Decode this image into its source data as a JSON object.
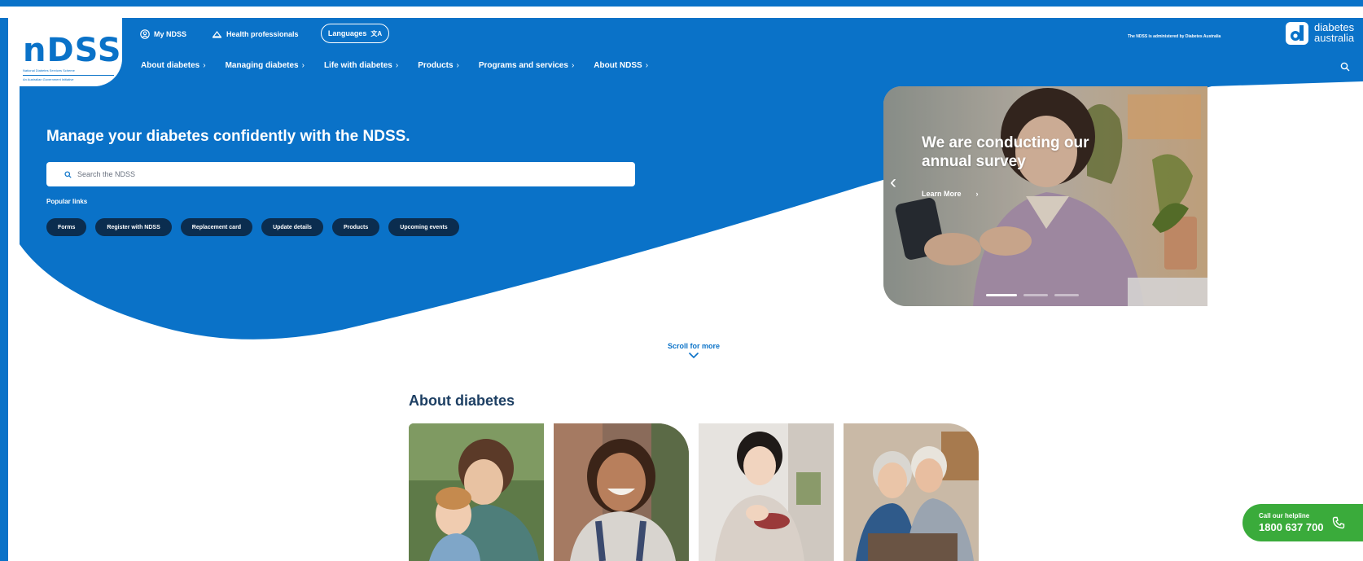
{
  "header": {
    "logo": {
      "text": "nDSS",
      "tagline": "National Diabetes Services Scheme",
      "subtagline": "An Australian Government Initiative"
    },
    "utility_links": [
      {
        "label": "My NDSS",
        "icon": "user-icon"
      },
      {
        "label": "Health professionals",
        "icon": "stethoscope-icon"
      }
    ],
    "language_button": {
      "label": "Languages",
      "glyph": "文A"
    },
    "admin_text": "The NDSS is administered by Diabetes Australia",
    "partner_logo": {
      "line1": "diabetes",
      "line2": "australia"
    },
    "nav": [
      {
        "label": "About diabetes"
      },
      {
        "label": "Managing diabetes"
      },
      {
        "label": "Life with diabetes"
      },
      {
        "label": "Products"
      },
      {
        "label": "Programs and services"
      },
      {
        "label": "About NDSS"
      }
    ]
  },
  "hero": {
    "title": "Manage your diabetes confidently with the NDSS.",
    "search": {
      "placeholder": "Search the NDSS",
      "value": ""
    },
    "popular_title": "Popular links",
    "popular_links": [
      "Forms",
      "Register with NDSS",
      "Replacement card",
      "Update details",
      "Products",
      "Upcoming events"
    ]
  },
  "carousel": {
    "slide_title": "We are conducting our annual survey",
    "cta": "Learn More",
    "slide_count": 3,
    "active_slide": 1
  },
  "scroll_prompt": "Scroll for more",
  "about": {
    "title": "About diabetes"
  },
  "helpline": {
    "label": "Call our helpline",
    "number": "1800 637 700"
  },
  "colors": {
    "brand_blue": "#0a72c8",
    "chip_navy": "#0b2d4f",
    "helpline_green": "#3aab3b",
    "heading_navy": "#1d3f63"
  }
}
